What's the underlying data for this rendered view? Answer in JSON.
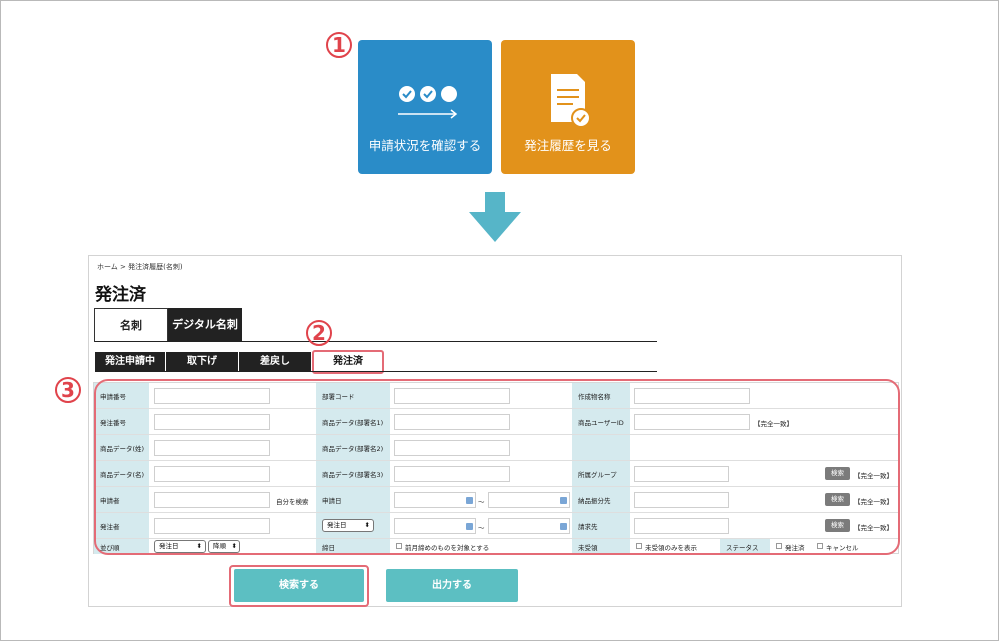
{
  "annotations": {
    "step1": "1",
    "step2": "2",
    "step3": "3"
  },
  "tiles": {
    "check_status_label": "申請状況を確認する",
    "order_history_label": "発注履歴を見る"
  },
  "colors": {
    "tile_blue": "#2a8cc8",
    "tile_orange": "#e2921b",
    "accent_teal": "#5cbfc2",
    "highlight_red": "#e46b76",
    "label_bg": "#d5eaee"
  },
  "breadcrumb": "ホーム > 発注済履歴(名刺)",
  "page_title": "発注済",
  "tabs": [
    "名刺",
    "デジタル名刺"
  ],
  "subtabs": [
    "発注申請中",
    "取下げ",
    "差戻し",
    "発注済"
  ],
  "form": {
    "application_no": "申請番号",
    "dept_code": "部署コード",
    "creation_name": "作成物名称",
    "order_no": "発注番号",
    "product_dept1": "商品データ(部署名1)",
    "product_user_id": "商品ユーザーID",
    "exact_match": "【完全一致】",
    "product_last": "商品データ(姓)",
    "product_dept2": "商品データ(部署名2)",
    "product_first": "商品データ(名)",
    "product_dept3": "商品データ(部署名3)",
    "group": "所属グループ",
    "search_btn": "検索",
    "applicant": "申請者",
    "search_self": "自分を検索",
    "application_date": "申請日",
    "tilde": "～",
    "delivery_dest": "納品振分先",
    "orderer": "発注者",
    "order_date_select": "発注日",
    "billing": "請求先",
    "sort": "並び順",
    "sort_field": "発注日",
    "sort_dir": "降順",
    "closing": "締日",
    "closing_option": "前月締めのものを対象とする",
    "unreceived": "未受領",
    "unreceived_option": "未受領のみを表示",
    "status": "ステータス",
    "status_ordered": "発注済",
    "status_cancel": "キャンセル"
  },
  "buttons": {
    "search": "検索する",
    "export": "出力する"
  }
}
